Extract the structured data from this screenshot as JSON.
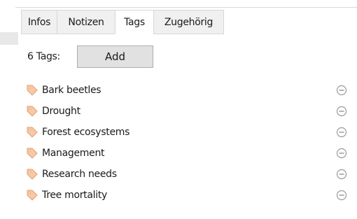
{
  "tabs": [
    {
      "label": "Infos",
      "active": false
    },
    {
      "label": "Notizen",
      "active": false
    },
    {
      "label": "Tags",
      "active": true
    },
    {
      "label": "Zugehörig",
      "active": false
    }
  ],
  "tag_count_label": "6 Tags:",
  "add_label": "Add",
  "tags": [
    {
      "label": "Bark beetles"
    },
    {
      "label": "Drought"
    },
    {
      "label": "Forest ecosystems"
    },
    {
      "label": "Management"
    },
    {
      "label": "Research needs"
    },
    {
      "label": "Tree mortality"
    }
  ],
  "icons": {
    "tag": "tag-icon",
    "remove": "remove-icon"
  },
  "colors": {
    "tag_icon_fill": "#f7c9a6",
    "tag_icon_stroke": "#e3a070",
    "remove_icon": "#9a9a9a"
  }
}
